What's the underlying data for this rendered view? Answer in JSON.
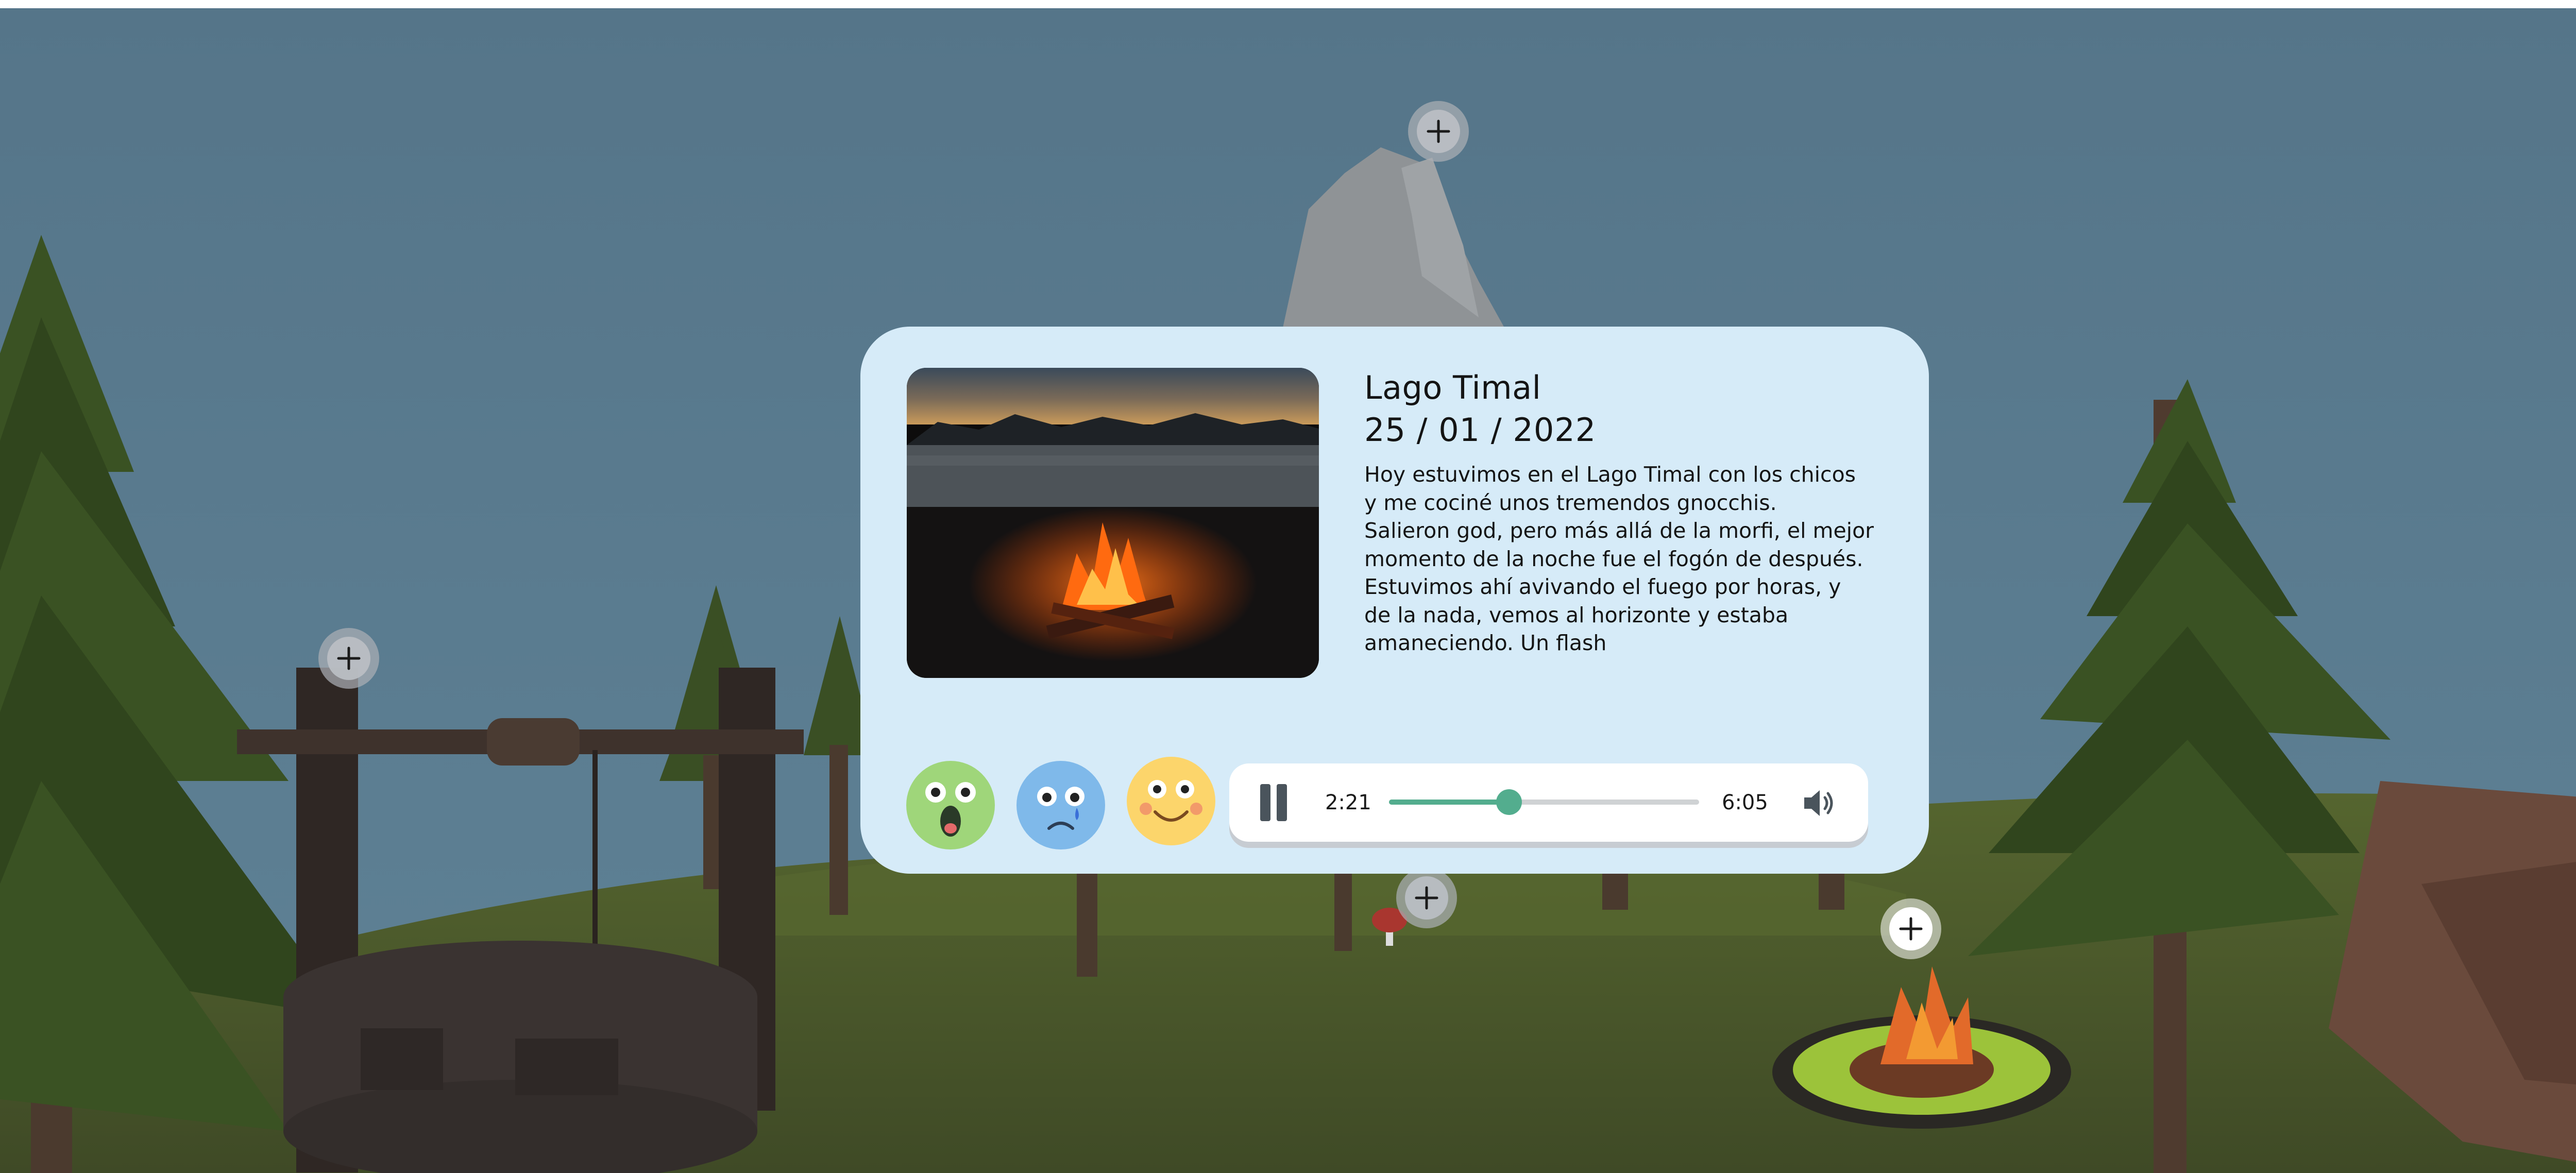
{
  "entry": {
    "title": "Lago Timal",
    "date": "25 / 01 / 2022",
    "body": "Hoy estuvimos en el Lago Timal con los chicos\ny me cociné unos tremendos gnocchis.\nSalieron god, pero más allá de la morfi, el mejor\nmomento de la noche fue el fogón de después.\nEstuvimos ahí avivando el fuego por horas, y\nde la nada, vemos al horizonte y estaba\namaneciendo. Un flash"
  },
  "reactions": [
    {
      "icon": "surprised-face-icon",
      "color": "#9fd67a"
    },
    {
      "icon": "sad-face-icon",
      "color": "#7fb9ea"
    },
    {
      "icon": "happy-face-icon",
      "color": "#fcd56b"
    }
  ],
  "player": {
    "state": "playing",
    "current_time": "2:21",
    "total_time": "6:05",
    "progress": 0.387
  },
  "hotspots": [
    {
      "icon": "plus-icon",
      "target": "mountain"
    },
    {
      "icon": "plus-icon",
      "target": "well"
    },
    {
      "icon": "plus-icon",
      "target": "mushroom"
    },
    {
      "icon": "plus-icon",
      "target": "campfire",
      "active": true
    }
  ],
  "colors": {
    "sky": "#587b8f",
    "card": "#d6ebf8",
    "accent": "#53ad8e",
    "grass": "#4f5e32"
  }
}
